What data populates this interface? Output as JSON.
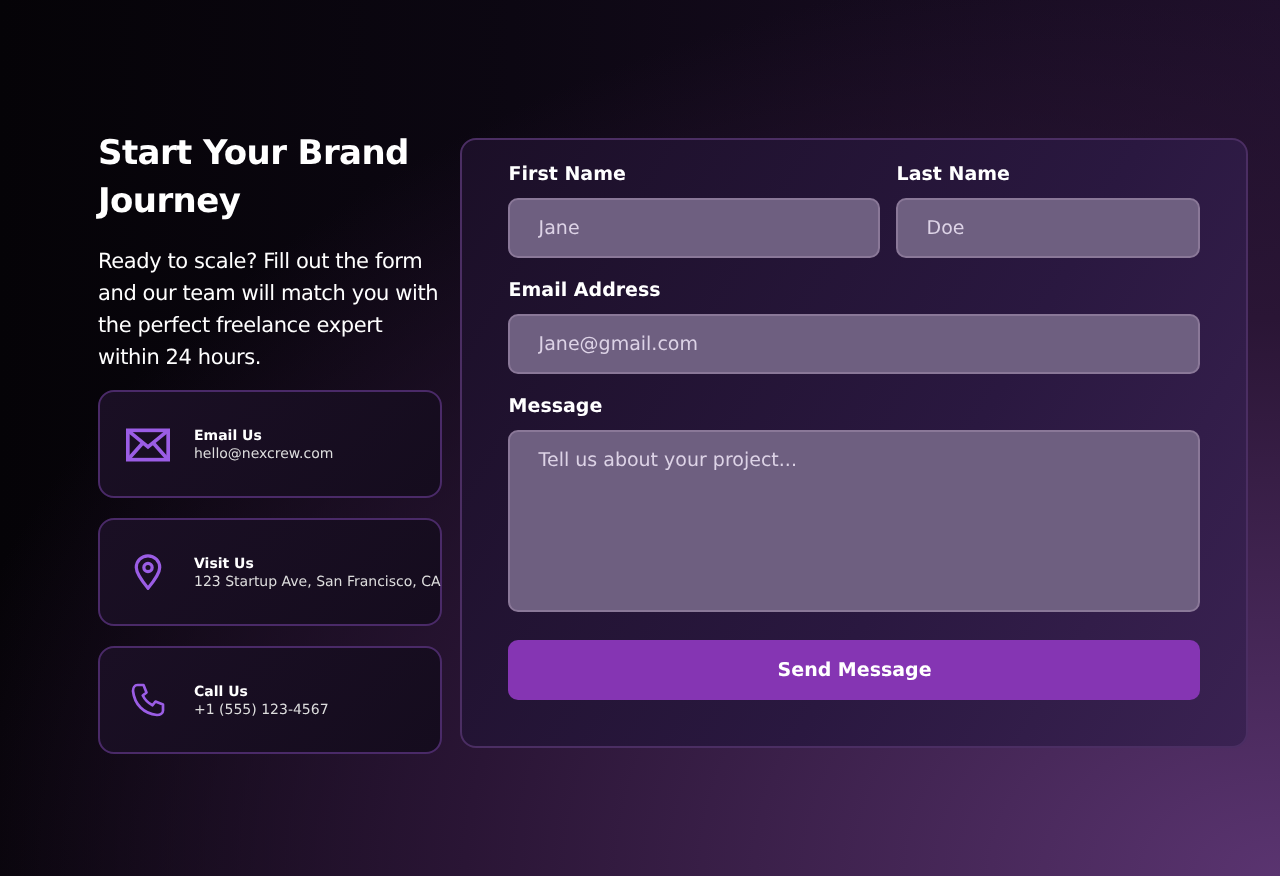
{
  "heading": "Start Your Brand Journey",
  "intro": "Ready to scale? Fill out the form and our team will match you with the perfect freelance expert within 24 hours.",
  "contacts": [
    {
      "kind": "email",
      "title": "Email Us",
      "detail": "hello@nexcrew.com"
    },
    {
      "kind": "location",
      "title": "Visit Us",
      "detail": "123 Startup Ave, San Francisco, CA"
    },
    {
      "kind": "phone",
      "title": "Call Us",
      "detail": "+1 (555) 123-4567"
    }
  ],
  "form": {
    "first_name": {
      "label": "First Name",
      "placeholder": "Jane"
    },
    "last_name": {
      "label": "Last Name",
      "placeholder": "Doe"
    },
    "email": {
      "label": "Email Address",
      "placeholder": "Jane@gmail.com"
    },
    "message": {
      "label": "Message",
      "placeholder": "Tell us about your project..."
    },
    "submit": "Send Message"
  }
}
